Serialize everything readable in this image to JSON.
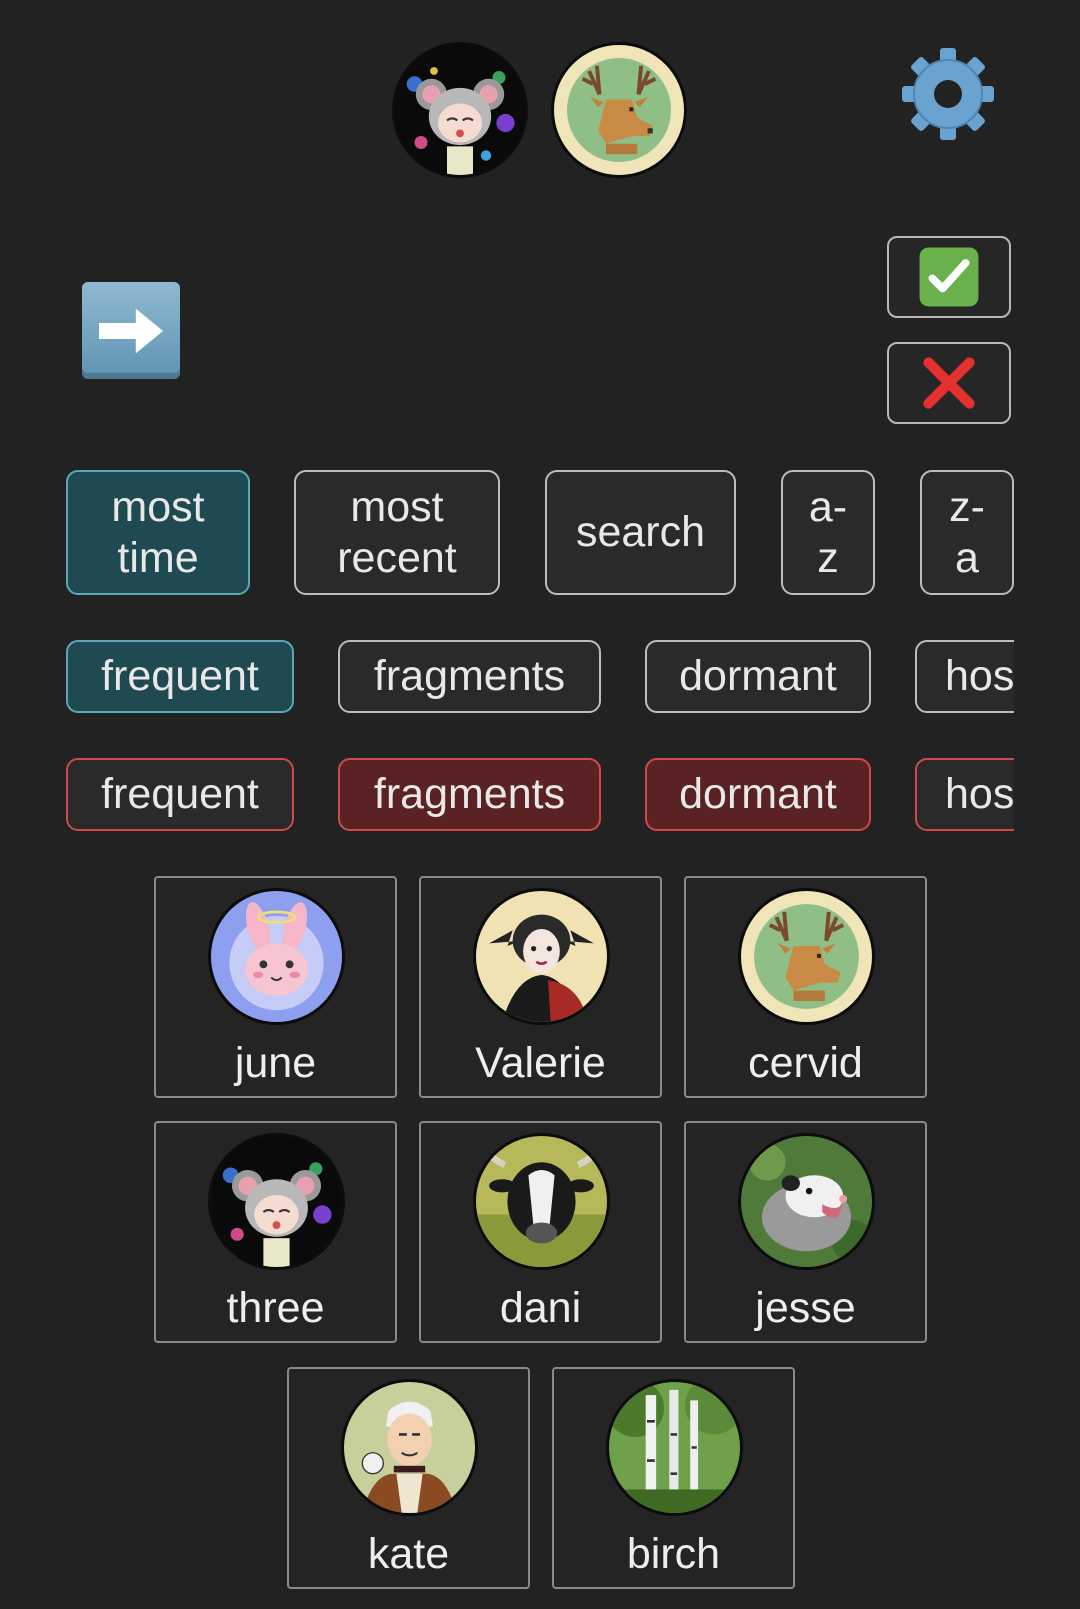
{
  "header": {
    "fronters": [
      {
        "name": "three",
        "avatar_icon": "mouse-girl-avatar"
      },
      {
        "name": "cervid",
        "avatar_icon": "deer-avatar"
      }
    ],
    "settings_icon": "gear-icon"
  },
  "controls": {
    "switch_icon": "right-arrow-icon",
    "confirm_icon": "check-icon",
    "cancel_icon": "cross-icon"
  },
  "sort_options": [
    {
      "label": "most\ntime",
      "selected": true
    },
    {
      "label": "most\nrecent",
      "selected": false
    },
    {
      "label": "search",
      "selected": false
    },
    {
      "label": "a-\nz",
      "selected": false
    },
    {
      "label": "z-\na",
      "selected": false
    }
  ],
  "include_tags": [
    {
      "label": "frequent",
      "selected": true
    },
    {
      "label": "fragments",
      "selected": false
    },
    {
      "label": "dormant",
      "selected": false
    },
    {
      "label": "hos",
      "selected": false
    }
  ],
  "exclude_tags": [
    {
      "label": "frequent",
      "selected": false
    },
    {
      "label": "fragments",
      "selected": true
    },
    {
      "label": "dormant",
      "selected": true
    },
    {
      "label": "hos",
      "selected": false
    }
  ],
  "members": [
    {
      "name": "june"
    },
    {
      "name": "Valerie"
    },
    {
      "name": "cervid"
    },
    {
      "name": "three"
    },
    {
      "name": "dani"
    },
    {
      "name": "jesse"
    },
    {
      "name": "kate"
    },
    {
      "name": "birch"
    }
  ],
  "colors": {
    "background": "#222222",
    "selected_teal": "#1f4a52",
    "exclude_red": "#cf4a4a"
  }
}
